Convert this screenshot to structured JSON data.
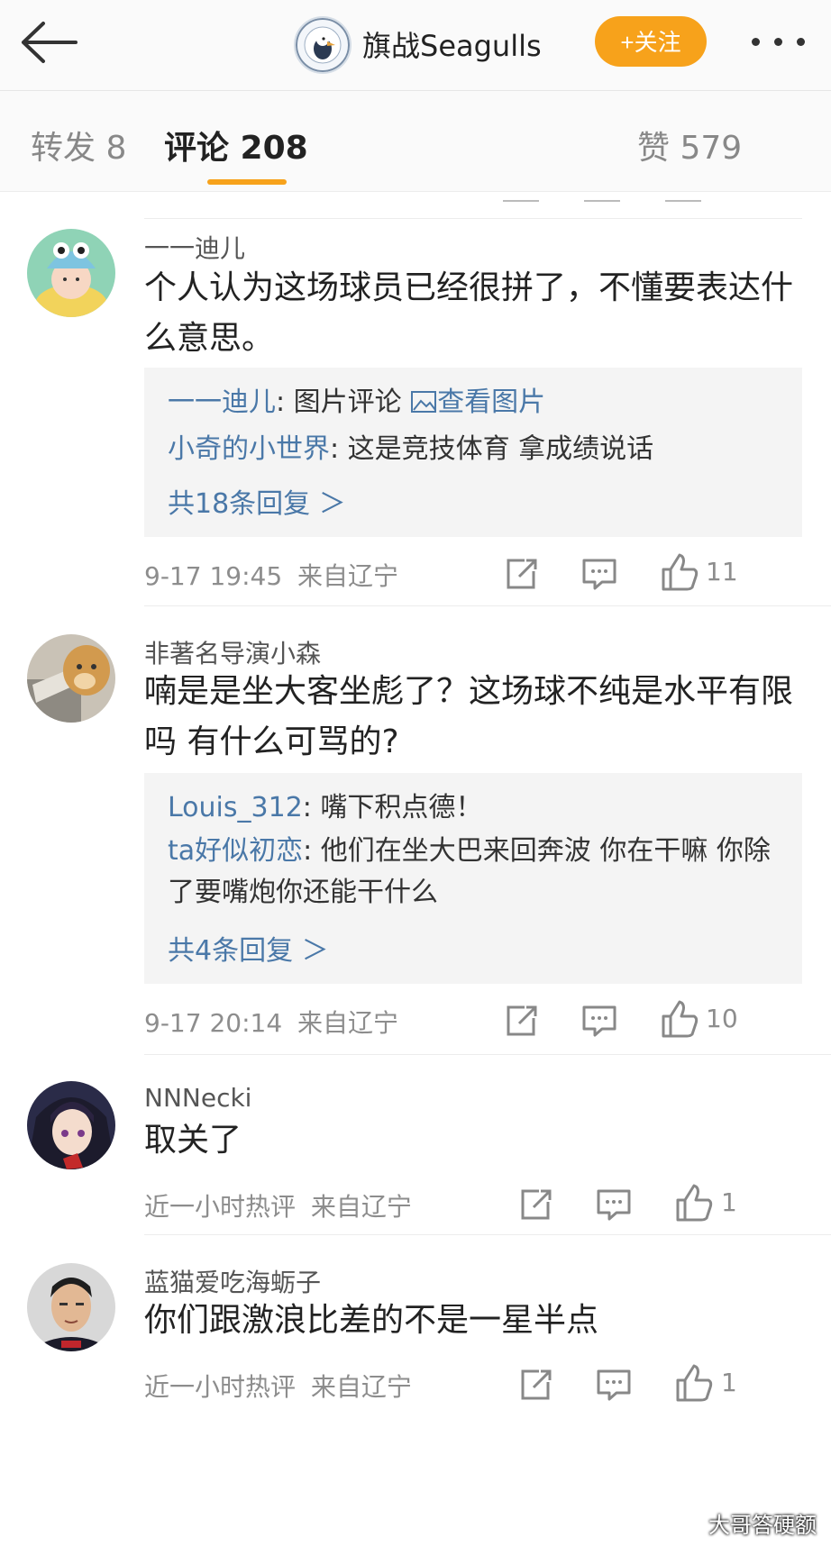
{
  "header": {
    "back_icon": "back-arrow-icon",
    "account_name": "旗战Seagulls",
    "follow_label": "+关注",
    "more_icon": "more-dots-icon",
    "accent_color": "#f7a21b"
  },
  "tabs": [
    {
      "label": "转发 8",
      "active": false
    },
    {
      "label": "评论 208",
      "active": true
    },
    {
      "label": "赞 579",
      "active": false
    }
  ],
  "comments": [
    {
      "user": "一一迪儿",
      "text": "个人认为这场球员已经很拼了，不懂要表达什么意思。",
      "replies": [
        {
          "name": "一一迪儿",
          "text": ": 图片评论 ",
          "link": "查看图片"
        },
        {
          "name": "小奇的小世界",
          "text": ": 这是竞技体育  拿成绩说话"
        }
      ],
      "more_replies": "共18条回复 ＞",
      "time": "9-17 19:45",
      "location": "来自辽宁",
      "likes": "11"
    },
    {
      "user": "非著名导演小森",
      "text": "喃是是坐大客坐彪了？这场球不纯是水平有限吗 有什么可骂的?",
      "replies": [
        {
          "name": "Louis_312",
          "text": ": 嘴下积点德！"
        },
        {
          "name": "ta好似初恋",
          "text": ": 他们在坐大巴来回奔波 你在干嘛 你除了要嘴炮你还能干什么"
        }
      ],
      "more_replies": "共4条回复 ＞",
      "time": "9-17 20:14",
      "location": "来自辽宁",
      "likes": "10"
    },
    {
      "user": "NNNecki",
      "text": "取关了",
      "time": "近一小时热评",
      "location": "来自辽宁",
      "likes": "1"
    },
    {
      "user": "蓝猫爱吃海蛎子",
      "text": "你们跟激浪比差的不是一星半点",
      "time": "近一小时热评",
      "location": "来自辽宁",
      "likes": "1"
    }
  ],
  "icons": {
    "share": "share-icon",
    "comment": "comment-icon",
    "like": "thumbs-up-icon"
  },
  "watermark": "大哥答硬额"
}
